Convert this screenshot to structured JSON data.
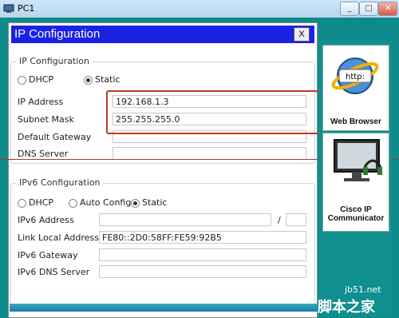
{
  "window": {
    "title": "PC1",
    "minimize": "_",
    "maximize": "□",
    "close": "✕"
  },
  "dialog": {
    "title": "IP Configuration",
    "close_label": "X"
  },
  "ipv4": {
    "legend": "IP Configuration",
    "dhcp_label": "DHCP",
    "static_label": "Static",
    "mode": "Static",
    "fields": [
      {
        "label": "IP Address",
        "value": "192.168.1.3"
      },
      {
        "label": "Subnet Mask",
        "value": "255.255.255.0"
      },
      {
        "label": "Default Gateway",
        "value": ""
      },
      {
        "label": "DNS Server",
        "value": ""
      }
    ]
  },
  "ipv6": {
    "legend": "IPv6 Configuration",
    "dhcp_label": "DHCP",
    "auto_label": "Auto Config",
    "static_label": "Static",
    "mode": "Static",
    "address_label": "IPv6 Address",
    "address_value": "",
    "prefix_sep": "/",
    "prefix_value": "",
    "link_local_label": "Link Local Address",
    "link_local_value": "FE80::2D0:58FF:FE59:92B5",
    "gateway_label": "IPv6 Gateway",
    "gateway_value": "",
    "dns_label": "IPv6 DNS Server",
    "dns_value": ""
  },
  "apps": [
    {
      "label": "Web Browser",
      "icon": "globe-icon",
      "icon_text": "http:"
    },
    {
      "label": "Cisco IP Communicator",
      "icon": "headset-monitor-icon"
    }
  ],
  "watermark": {
    "site": "jb51.net",
    "cn": "脚本之家"
  },
  "colors": {
    "dialog_title_bg": "#1a22e6",
    "highlight": "#c0362c",
    "teal": "#0e8a8a"
  }
}
